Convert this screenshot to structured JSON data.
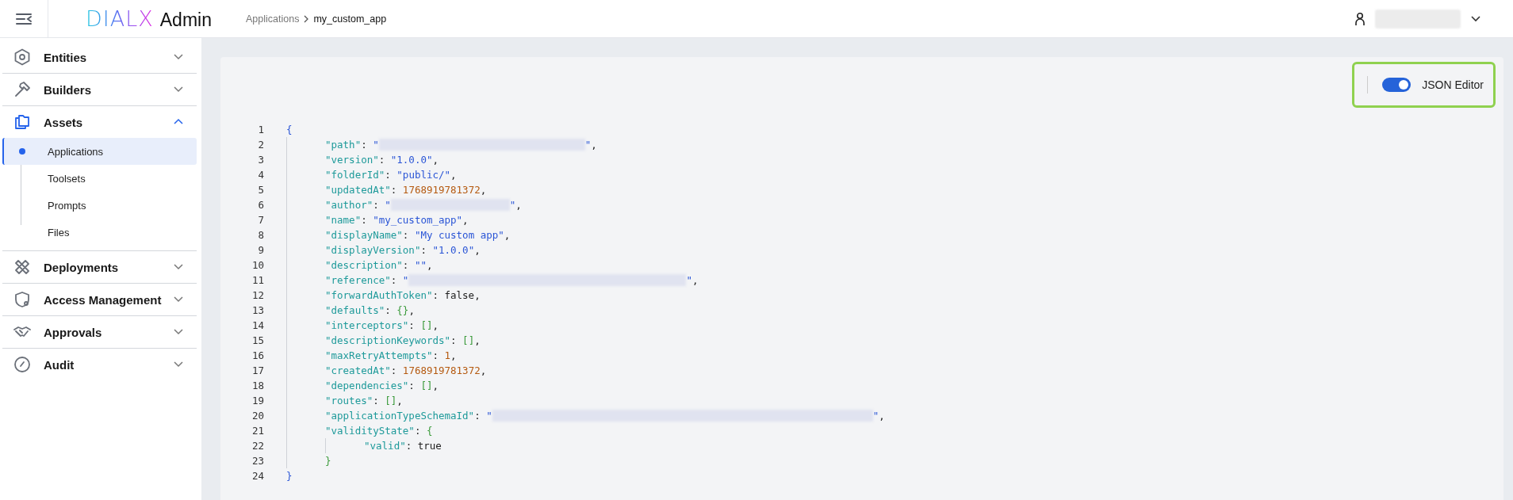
{
  "header": {
    "logo": {
      "brand": "DIALX",
      "product": "Admin"
    },
    "breadcrumb": [
      {
        "label": "Applications",
        "current": false
      },
      {
        "label": "my_custom_app",
        "current": true
      }
    ],
    "user": {
      "redacted": true
    }
  },
  "sidebar": {
    "items": [
      {
        "label": "Entities",
        "expanded": false
      },
      {
        "label": "Builders",
        "expanded": false
      },
      {
        "label": "Assets",
        "expanded": true,
        "children": [
          {
            "label": "Applications",
            "selected": true
          },
          {
            "label": "Toolsets",
            "selected": false
          },
          {
            "label": "Prompts",
            "selected": false
          },
          {
            "label": "Files",
            "selected": false
          }
        ]
      },
      {
        "label": "Deployments",
        "expanded": false
      },
      {
        "label": "Access Management",
        "expanded": false
      },
      {
        "label": "Approvals",
        "expanded": false
      },
      {
        "label": "Audit",
        "expanded": false
      }
    ]
  },
  "editor": {
    "json_editor_toggle": {
      "label": "JSON Editor",
      "on": true
    },
    "lines": [
      {
        "number": "1",
        "tokens": [
          {
            "kind": "bracket",
            "text": "{"
          }
        ],
        "children": [
          {
            "number": "2",
            "tokens": [
              {
                "kind": "key",
                "text": "\"path\""
              },
              {
                "kind": "punct",
                "text": ": "
              },
              {
                "kind": "string",
                "text": "\""
              },
              {
                "kind": "redacted"
              },
              {
                "kind": "string",
                "text": "\""
              },
              {
                "kind": "punct",
                "text": ","
              }
            ]
          },
          {
            "number": "3",
            "tokens": [
              {
                "kind": "key",
                "text": "\"version\""
              },
              {
                "kind": "punct",
                "text": ": "
              },
              {
                "kind": "string",
                "text": "\"1.0.0\""
              },
              {
                "kind": "punct",
                "text": ","
              }
            ]
          },
          {
            "number": "4",
            "tokens": [
              {
                "kind": "key",
                "text": "\"folderId\""
              },
              {
                "kind": "punct",
                "text": ": "
              },
              {
                "kind": "string",
                "text": "\"public/\""
              },
              {
                "kind": "punct",
                "text": ","
              }
            ]
          },
          {
            "number": "5",
            "tokens": [
              {
                "kind": "key",
                "text": "\"updatedAt\""
              },
              {
                "kind": "punct",
                "text": ": "
              },
              {
                "kind": "number",
                "text": "1768919781372"
              },
              {
                "kind": "punct",
                "text": ","
              }
            ]
          },
          {
            "number": "6",
            "tokens": [
              {
                "kind": "key",
                "text": "\"author\""
              },
              {
                "kind": "punct",
                "text": ": "
              },
              {
                "kind": "string",
                "text": "\""
              },
              {
                "kind": "redacted"
              },
              {
                "kind": "string",
                "text": "\""
              },
              {
                "kind": "punct",
                "text": ","
              }
            ]
          },
          {
            "number": "7",
            "tokens": [
              {
                "kind": "key",
                "text": "\"name\""
              },
              {
                "kind": "punct",
                "text": ": "
              },
              {
                "kind": "string",
                "text": "\"my_custom_app\""
              },
              {
                "kind": "punct",
                "text": ","
              }
            ]
          },
          {
            "number": "8",
            "tokens": [
              {
                "kind": "key",
                "text": "\"displayName\""
              },
              {
                "kind": "punct",
                "text": ": "
              },
              {
                "kind": "string",
                "text": "\"My custom app\""
              },
              {
                "kind": "punct",
                "text": ","
              }
            ]
          },
          {
            "number": "9",
            "tokens": [
              {
                "kind": "key",
                "text": "\"displayVersion\""
              },
              {
                "kind": "punct",
                "text": ": "
              },
              {
                "kind": "string",
                "text": "\"1.0.0\""
              },
              {
                "kind": "punct",
                "text": ","
              }
            ]
          },
          {
            "number": "10",
            "tokens": [
              {
                "kind": "key",
                "text": "\"description\""
              },
              {
                "kind": "punct",
                "text": ": "
              },
              {
                "kind": "string",
                "text": "\"\""
              },
              {
                "kind": "punct",
                "text": ","
              }
            ]
          },
          {
            "number": "11",
            "tokens": [
              {
                "kind": "key",
                "text": "\"reference\""
              },
              {
                "kind": "punct",
                "text": ": "
              },
              {
                "kind": "string",
                "text": "\""
              },
              {
                "kind": "redacted"
              },
              {
                "kind": "string",
                "text": "\""
              },
              {
                "kind": "punct",
                "text": ","
              }
            ]
          },
          {
            "number": "12",
            "tokens": [
              {
                "kind": "key",
                "text": "\"forwardAuthToken\""
              },
              {
                "kind": "punct",
                "text": ": false,"
              }
            ]
          },
          {
            "number": "13",
            "tokens": [
              {
                "kind": "key",
                "text": "\"defaults\""
              },
              {
                "kind": "punct",
                "text": ": "
              },
              {
                "kind": "bracket2",
                "text": "{}"
              },
              {
                "kind": "punct",
                "text": ","
              }
            ]
          },
          {
            "number": "14",
            "tokens": [
              {
                "kind": "key",
                "text": "\"interceptors\""
              },
              {
                "kind": "punct",
                "text": ": "
              },
              {
                "kind": "bracket2",
                "text": "[]"
              },
              {
                "kind": "punct",
                "text": ","
              }
            ]
          },
          {
            "number": "15",
            "tokens": [
              {
                "kind": "key",
                "text": "\"descriptionKeywords\""
              },
              {
                "kind": "punct",
                "text": ": "
              },
              {
                "kind": "bracket2",
                "text": "[]"
              },
              {
                "kind": "punct",
                "text": ","
              }
            ]
          },
          {
            "number": "16",
            "tokens": [
              {
                "kind": "key",
                "text": "\"maxRetryAttempts\""
              },
              {
                "kind": "punct",
                "text": ": "
              },
              {
                "kind": "number",
                "text": "1"
              },
              {
                "kind": "punct",
                "text": ","
              }
            ]
          },
          {
            "number": "17",
            "tokens": [
              {
                "kind": "key",
                "text": "\"createdAt\""
              },
              {
                "kind": "punct",
                "text": ": "
              },
              {
                "kind": "number",
                "text": "1768919781372"
              },
              {
                "kind": "punct",
                "text": ","
              }
            ]
          },
          {
            "number": "18",
            "tokens": [
              {
                "kind": "key",
                "text": "\"dependencies\""
              },
              {
                "kind": "punct",
                "text": ": "
              },
              {
                "kind": "bracket2",
                "text": "[]"
              },
              {
                "kind": "punct",
                "text": ","
              }
            ]
          },
          {
            "number": "19",
            "tokens": [
              {
                "kind": "key",
                "text": "\"routes\""
              },
              {
                "kind": "punct",
                "text": ": "
              },
              {
                "kind": "bracket2",
                "text": "[]"
              },
              {
                "kind": "punct",
                "text": ","
              }
            ]
          },
          {
            "number": "20",
            "tokens": [
              {
                "kind": "key",
                "text": "\"applicationTypeSchemaId\""
              },
              {
                "kind": "punct",
                "text": ": "
              },
              {
                "kind": "string",
                "text": "\""
              },
              {
                "kind": "redacted"
              },
              {
                "kind": "string",
                "text": "\""
              },
              {
                "kind": "punct",
                "text": ","
              }
            ]
          },
          {
            "number": "21",
            "tokens": [
              {
                "kind": "key",
                "text": "\"validityState\""
              },
              {
                "kind": "punct",
                "text": ": "
              },
              {
                "kind": "bracket2",
                "text": "{"
              }
            ],
            "children": [
              {
                "number": "22",
                "tokens": [
                  {
                    "kind": "key",
                    "text": "\"valid\""
                  },
                  {
                    "kind": "punct",
                    "text": ": true"
                  }
                ]
              }
            ]
          },
          {
            "number": "23",
            "tokens": [
              {
                "kind": "bracket2",
                "text": "}"
              }
            ]
          }
        ]
      },
      {
        "number": "24",
        "tokens": [
          {
            "kind": "bracket",
            "text": "}"
          }
        ]
      }
    ]
  }
}
